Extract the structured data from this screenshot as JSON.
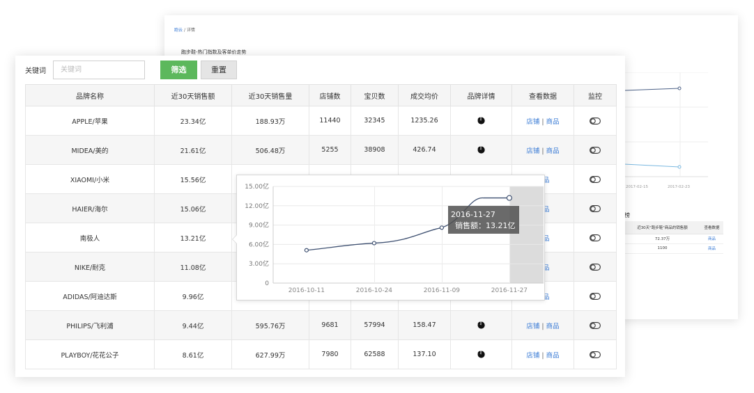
{
  "back_card": {
    "breadcrumb": {
      "root": "跑云",
      "separator": "/",
      "current": "详情"
    },
    "title": "跑步鞋-热门指数及客单价走势",
    "dates": [
      "2017-02-15",
      "2017-02-23"
    ],
    "section_title": "榜",
    "table": {
      "headers": [
        "近30天\"跑步鞋\"商品的销售额",
        "查看数据"
      ],
      "rows": [
        {
          "value": "72.37万",
          "link": "商品"
        },
        {
          "value": "1100",
          "link": "商品"
        }
      ]
    }
  },
  "filter": {
    "label": "关键词",
    "placeholder": "关键词",
    "filter_button": "筛选",
    "reset_button": "重置"
  },
  "table": {
    "headers": [
      "品牌名称",
      "近30天销售额",
      "近30天销售量",
      "店铺数",
      "宝贝数",
      "成交均价",
      "品牌详情",
      "查看数据",
      "监控"
    ],
    "link_shop": "店铺",
    "link_sep": "|",
    "link_goods": "商品",
    "rows": [
      {
        "brand": "APPLE/苹果",
        "sales": "23.34亿",
        "volume": "188.93万",
        "shops": "11440",
        "items": "32345",
        "avg_price": "1235.26"
      },
      {
        "brand": "MIDEA/美的",
        "sales": "21.61亿",
        "volume": "506.48万",
        "shops": "5255",
        "items": "38908",
        "avg_price": "426.74"
      },
      {
        "brand": "XIAOMI/小米",
        "sales": "15.56亿",
        "volume": "",
        "shops": "",
        "items": "",
        "avg_price": ""
      },
      {
        "brand": "HAIER/海尔",
        "sales": "15.06亿",
        "volume": "",
        "shops": "",
        "items": "",
        "avg_price": ""
      },
      {
        "brand": "南极人",
        "sales": "13.21亿",
        "volume": "",
        "shops": "",
        "items": "",
        "avg_price": ""
      },
      {
        "brand": "NIKE/耐克",
        "sales": "11.08亿",
        "volume": "",
        "shops": "",
        "items": "",
        "avg_price": ""
      },
      {
        "brand": "ADIDAS/阿迪达斯",
        "sales": "9.96亿",
        "volume": "",
        "shops": "",
        "items": "",
        "avg_price": ""
      },
      {
        "brand": "PHILIPS/飞利浦",
        "sales": "9.44亿",
        "volume": "595.76万",
        "shops": "9681",
        "items": "57994",
        "avg_price": "158.47"
      },
      {
        "brand": "PLAYBOY/花花公子",
        "sales": "8.61亿",
        "volume": "627.99万",
        "shops": "7980",
        "items": "62588",
        "avg_price": "137.10"
      }
    ]
  },
  "chart_data": {
    "type": "line",
    "x": [
      "2016-10-11",
      "2016-10-24",
      "2016-11-09",
      "2016-11-27"
    ],
    "x_tick_labels": [
      "2016-10-11",
      "2016-10-24",
      "2016-11-09",
      "2016-11-27"
    ],
    "series": [
      {
        "values": [
          5.1,
          6.2,
          8.6,
          13.21
        ]
      }
    ],
    "y_tick_labels": [
      "0",
      "3.00亿",
      "6.00亿",
      "9.00亿",
      "12.00亿",
      "15.00亿"
    ],
    "ylim": [
      0,
      15
    ],
    "grid": true,
    "tooltip": {
      "date": "2016-11-27",
      "label": "销售额：13.21亿"
    }
  },
  "colors": {
    "accent_green": "#5cb85c",
    "link_blue": "#3a7bd5",
    "line_color": "#3d4f70"
  }
}
